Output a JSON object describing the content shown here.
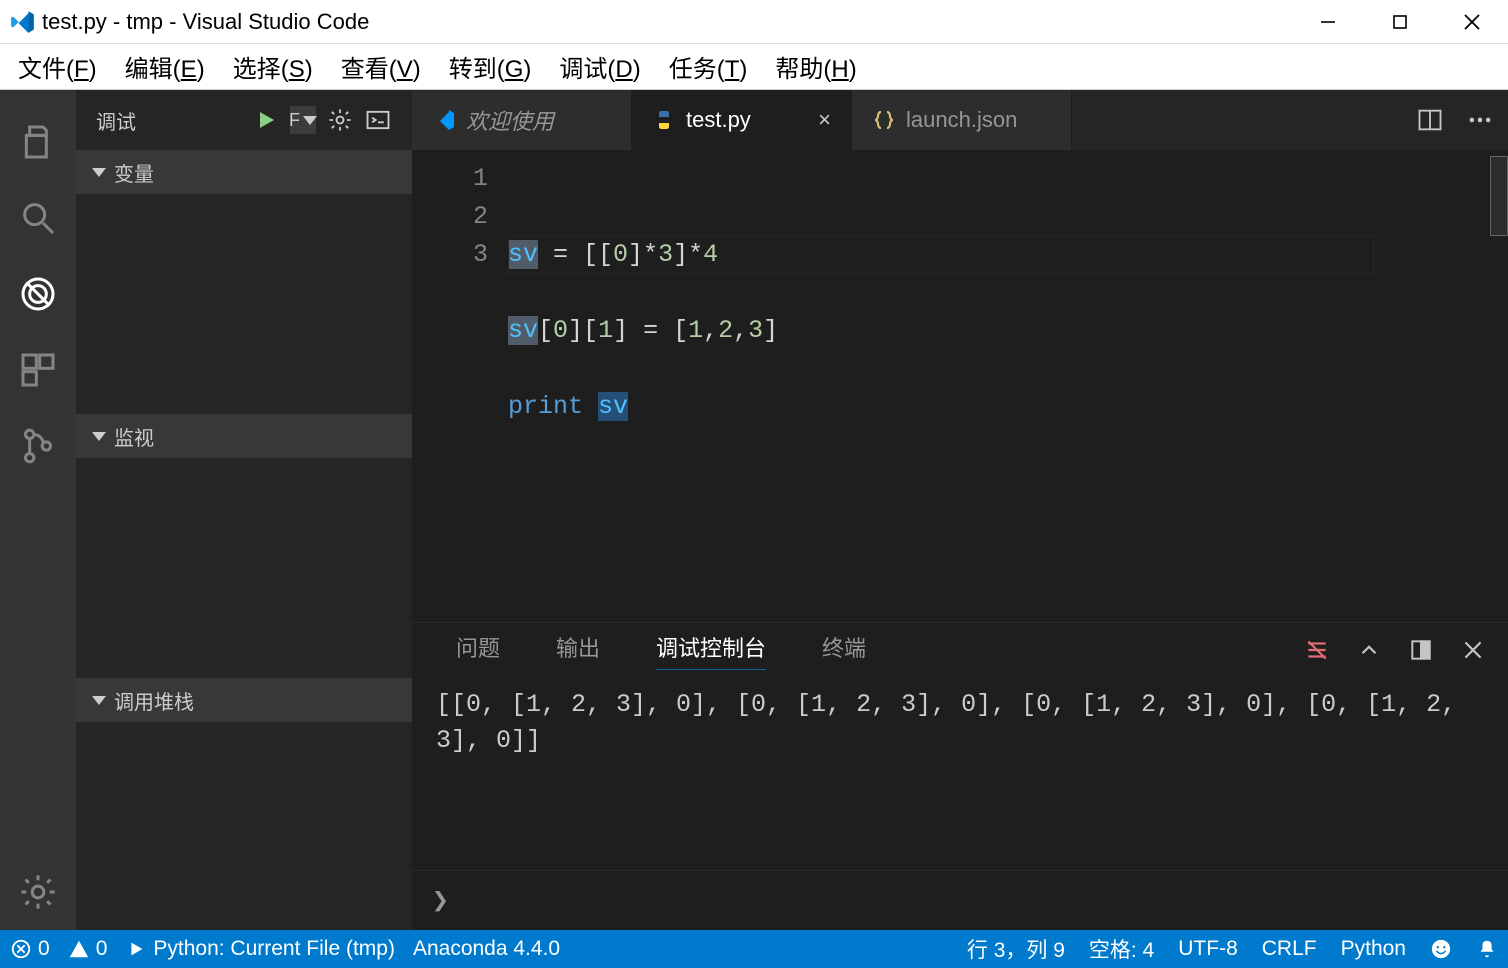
{
  "app": {
    "title": "test.py - tmp - Visual Studio Code"
  },
  "menubar": [
    {
      "label": "文件",
      "u": "F"
    },
    {
      "label": "编辑",
      "u": "E"
    },
    {
      "label": "选择",
      "u": "S"
    },
    {
      "label": "查看",
      "u": "V"
    },
    {
      "label": "转到",
      "u": "G"
    },
    {
      "label": "调试",
      "u": "D"
    },
    {
      "label": "任务",
      "u": "T"
    },
    {
      "label": "帮助",
      "u": "H"
    }
  ],
  "sidepanel": {
    "title": "调试",
    "sections": [
      {
        "label": "变量"
      },
      {
        "label": "监视"
      },
      {
        "label": "调用堆栈"
      }
    ]
  },
  "tabs": [
    {
      "label": "欢迎使用",
      "icon": "vscode",
      "italic": true,
      "active": false
    },
    {
      "label": "test.py",
      "icon": "python",
      "italic": false,
      "active": true,
      "close": true
    },
    {
      "label": "launch.json",
      "icon": "json",
      "italic": false,
      "active": false
    }
  ],
  "code": {
    "gutter": [
      "1",
      "2",
      "3"
    ],
    "line1_a": "sv",
    "line1_b": " = [[",
    "line1_c": "0",
    "line1_d": "]*",
    "line1_e": "3",
    "line1_f": "]*",
    "line1_g": "4",
    "line2_a": "sv",
    "line2_b": "[",
    "line2_c": "0",
    "line2_d": "][",
    "line2_e": "1",
    "line2_f": "] = [",
    "line2_g": "1",
    "line2_h": ",",
    "line2_i": "2",
    "line2_j": ",",
    "line2_k": "3",
    "line2_l": "]",
    "line3_a": "print",
    "line3_b": " ",
    "line3_c": "sv"
  },
  "bottompanel": {
    "tabs": [
      {
        "label": "问题",
        "active": false
      },
      {
        "label": "输出",
        "active": false
      },
      {
        "label": "调试控制台",
        "active": true
      },
      {
        "label": "终端",
        "active": false
      }
    ],
    "output": "[[0, [1, 2, 3], 0], [0, [1, 2, 3], 0], [0, [1, 2, 3], 0], [0, [1, 2, 3], 0]]",
    "replPrompt": "❯"
  },
  "statusbar": {
    "errors": "0",
    "warnings": "0",
    "launch": "Python: Current File (tmp)",
    "interpreter": "Anaconda 4.4.0",
    "cursor": "行 3，列 9",
    "indent": "空格: 4",
    "encoding": "UTF-8",
    "eol": "CRLF",
    "language": "Python"
  }
}
